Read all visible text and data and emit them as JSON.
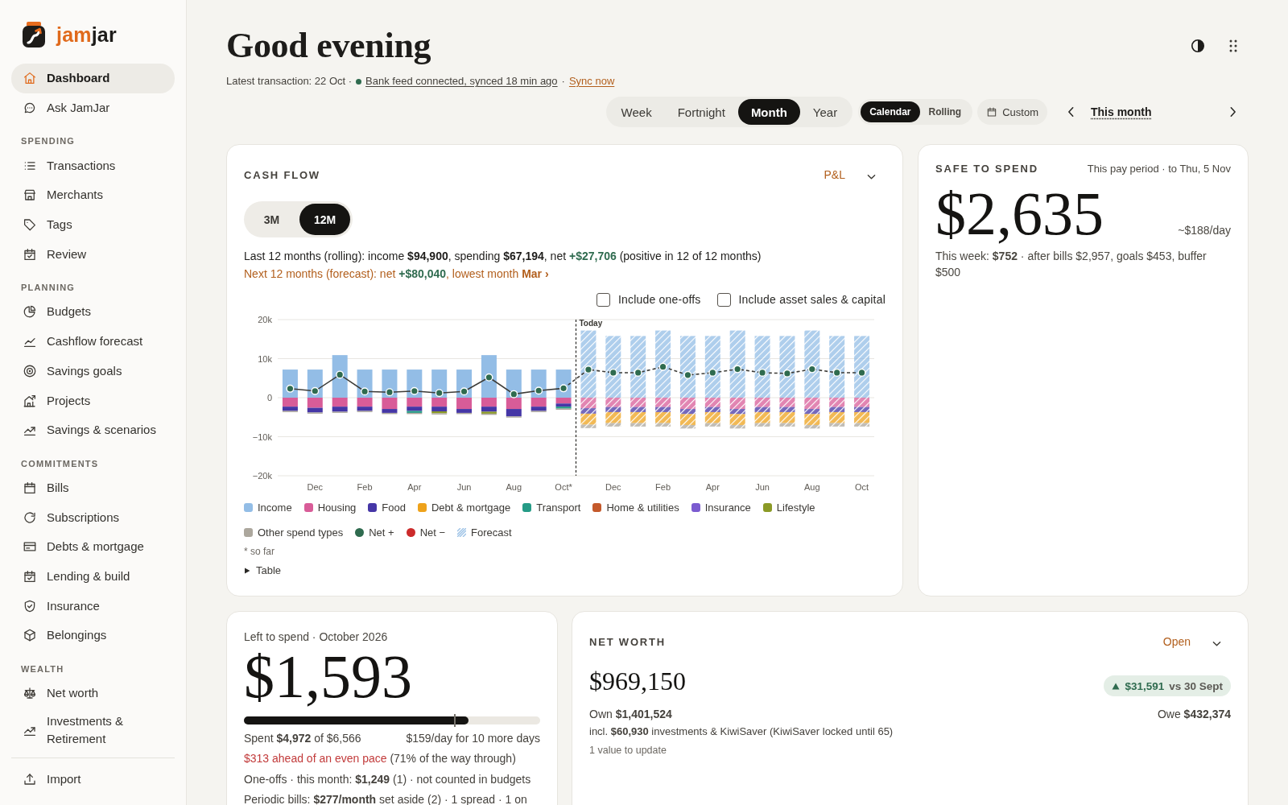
{
  "sidebar": {
    "logo": {
      "accent": "jam",
      "rest": "jar"
    },
    "sections": [
      {
        "items": [
          {
            "label": "Dashboard",
            "selected": true
          },
          {
            "label": "Ask JamJar",
            "selected": false
          }
        ]
      },
      {
        "title": "SPENDING",
        "items": [
          {
            "label": "Transactions",
            "selected": false
          },
          {
            "label": "Merchants",
            "selected": false
          },
          {
            "label": "Tags",
            "selected": false
          },
          {
            "label": "Review",
            "selected": false
          }
        ]
      },
      {
        "title": "PLANNING",
        "items": [
          {
            "label": "Budgets",
            "selected": false
          },
          {
            "label": "Cashflow forecast",
            "selected": false
          },
          {
            "label": "Savings goals",
            "selected": false
          },
          {
            "label": "Projects",
            "selected": false
          },
          {
            "label": "Savings & scenarios",
            "selected": false
          }
        ]
      },
      {
        "title": "COMMITMENTS",
        "items": [
          {
            "label": "Bills",
            "selected": false
          },
          {
            "label": "Subscriptions",
            "selected": false
          },
          {
            "label": "Debts & mortgage",
            "selected": false
          },
          {
            "label": "Lending & build",
            "selected": false
          },
          {
            "label": "Insurance",
            "selected": false
          },
          {
            "label": "Belongings",
            "selected": false
          }
        ]
      },
      {
        "title": "WEALTH",
        "items": [
          {
            "label": "Net worth",
            "selected": false
          },
          {
            "label": "Investments & Retirement",
            "selected": false
          }
        ]
      },
      {
        "items": [
          {
            "label": "Import",
            "selected": false
          }
        ]
      }
    ]
  },
  "header": {
    "title": "Good evening",
    "latest": "Latest transaction: 22 Oct ·",
    "bank_feed": {
      "text": "Bank feed connected, synced 18 min ago",
      "connected": true
    },
    "separator": "·",
    "sync_link": "Sync now"
  },
  "period": {
    "tabs": [
      {
        "label": "Week",
        "selected": false
      },
      {
        "label": "Fortnight",
        "selected": false
      },
      {
        "label": "Month",
        "selected": true
      },
      {
        "label": "Year",
        "selected": false
      }
    ],
    "modes": [
      {
        "label": "Calendar",
        "selected": true
      },
      {
        "label": "Rolling",
        "selected": false
      }
    ],
    "custom": "Custom",
    "current": "This month"
  },
  "cash_flow": {
    "title": "CASH FLOW",
    "view_link": "P&L",
    "ranges": [
      {
        "label": "3M",
        "selected": false
      },
      {
        "label": "12M",
        "selected": true
      }
    ],
    "summary": [
      {
        "text": "Last 12 months (rolling): income ",
        "kind": "plain"
      },
      {
        "text": "$94,900",
        "kind": "strong"
      },
      {
        "text": ", spending ",
        "kind": "plain"
      },
      {
        "text": "$67,194",
        "kind": "strong"
      },
      {
        "text": ", net ",
        "kind": "plain"
      },
      {
        "text": "+$27,706",
        "kind": "positive"
      },
      {
        "text": " (positive in 12 of 12 months)",
        "kind": "plain"
      }
    ],
    "forecast": [
      {
        "text": "Next 12 months (forecast): net ",
        "kind": "plain"
      },
      {
        "text": "+$80,040",
        "kind": "positive"
      },
      {
        "text": ", lowest month ",
        "kind": "plain"
      },
      {
        "text": "Mar ›",
        "kind": "strong"
      }
    ],
    "options": [
      {
        "label": "Include one-offs",
        "checked": false
      },
      {
        "label": "Include asset sales & capital",
        "checked": false
      }
    ],
    "chart_data": {
      "type": "bar",
      "stacked": true,
      "grid": true,
      "categories": [
        null,
        "Dec",
        null,
        "Feb",
        null,
        "Apr",
        null,
        "Jun",
        null,
        "Aug",
        null,
        "Oct*",
        null,
        "Dec",
        null,
        "Feb",
        null,
        "Apr",
        null,
        "Jun",
        null,
        "Aug",
        null,
        "Oct"
      ],
      "ylim": [
        -20000,
        20000
      ],
      "yticks": [
        {
          "value": 20000,
          "label": "20k"
        },
        {
          "value": 10000,
          "label": "10k"
        },
        {
          "value": 0,
          "label": "0"
        },
        {
          "value": -10000,
          "label": "−10k"
        },
        {
          "value": -20000,
          "label": "−20k"
        }
      ],
      "series": [
        {
          "name": "Income",
          "type": "bar",
          "color": "#93bde6",
          "values": [
            7200,
            7200,
            10900,
            7200,
            7200,
            7200,
            7200,
            7200,
            10900,
            7200,
            7200,
            7200,
            17200,
            15800,
            15800,
            17200,
            15800,
            15800,
            17200,
            15800,
            15800,
            17200,
            15800,
            15800
          ]
        },
        {
          "name": "Housing",
          "type": "bar",
          "color": "#d85c98",
          "values": [
            -2300,
            -2600,
            -2300,
            -2300,
            -2900,
            -2300,
            -2300,
            -2900,
            -2300,
            -2900,
            -2300,
            -1500,
            -2700,
            -2400,
            -2400,
            -2400,
            -2900,
            -2400,
            -2900,
            -2400,
            -2400,
            -2900,
            -2400,
            -2400
          ]
        },
        {
          "name": "Food",
          "type": "bar",
          "color": "#4536a6",
          "values": [
            -1100,
            -1200,
            -1300,
            -1100,
            -1000,
            -1100,
            -1200,
            -1000,
            -1300,
            -1900,
            -1100,
            -800,
            -1400,
            -1300,
            -1300,
            -1300,
            -1300,
            -1300,
            -1300,
            -1300,
            -1300,
            -1300,
            -1300,
            -1300
          ]
        },
        {
          "name": "Debt & mortgage",
          "type": "bar",
          "color": "#eea21b",
          "values": [
            0,
            0,
            0,
            0,
            0,
            0,
            0,
            0,
            0,
            0,
            0,
            0,
            -2800,
            -2800,
            -2800,
            -2800,
            -2800,
            -2800,
            -2800,
            -2800,
            -2800,
            -2800,
            -2800,
            -2800
          ]
        },
        {
          "name": "Transport",
          "type": "bar",
          "color": "#259b86",
          "values": [
            0,
            0,
            0,
            0,
            0,
            -500,
            0,
            0,
            0,
            0,
            0,
            -500,
            0,
            0,
            0,
            0,
            0,
            0,
            0,
            0,
            0,
            0,
            0,
            0
          ]
        },
        {
          "name": "Home & utilities",
          "type": "bar",
          "color": "#c4592b",
          "values": [
            0,
            0,
            0,
            0,
            0,
            0,
            0,
            0,
            0,
            0,
            0,
            0,
            0,
            0,
            0,
            0,
            0,
            0,
            0,
            0,
            0,
            0,
            0,
            0
          ]
        },
        {
          "name": "Insurance",
          "type": "bar",
          "color": "#7b5bd0",
          "values": [
            0,
            0,
            0,
            0,
            0,
            0,
            0,
            0,
            0,
            0,
            0,
            0,
            0,
            0,
            0,
            0,
            0,
            0,
            0,
            0,
            0,
            0,
            0,
            0
          ]
        },
        {
          "name": "Lifestyle",
          "type": "bar",
          "color": "#8b9a26",
          "values": [
            0,
            0,
            0,
            0,
            0,
            0,
            -500,
            0,
            -500,
            0,
            0,
            0,
            0,
            0,
            0,
            0,
            0,
            0,
            0,
            0,
            0,
            0,
            0,
            0
          ]
        },
        {
          "name": "Other spend types",
          "type": "bar",
          "color": "#aca79d",
          "values": [
            -300,
            -300,
            -300,
            -300,
            -300,
            -300,
            -300,
            -300,
            -300,
            -300,
            -300,
            -300,
            -900,
            -900,
            -900,
            -900,
            -900,
            -900,
            -900,
            -900,
            -900,
            -900,
            -900,
            -900
          ]
        },
        {
          "name": "Net +",
          "type": "line",
          "marker": "circle",
          "color": "#2f6b4f",
          "values": [
            2300,
            1700,
            5900,
            1600,
            1400,
            1700,
            1200,
            1600,
            5200,
            900,
            1800,
            2400,
            7200,
            6400,
            6400,
            7900,
            5800,
            6400,
            7300,
            6400,
            6200,
            7300,
            6400,
            6400
          ]
        }
      ],
      "annotations": [
        "Today"
      ]
    },
    "month_states": [
      {
        "forecast": false
      },
      {
        "forecast": false
      },
      {
        "forecast": false
      },
      {
        "forecast": false
      },
      {
        "forecast": false
      },
      {
        "forecast": false
      },
      {
        "forecast": false
      },
      {
        "forecast": false
      },
      {
        "forecast": false
      },
      {
        "forecast": false
      },
      {
        "forecast": false
      },
      {
        "forecast": false
      },
      {
        "forecast": true
      },
      {
        "forecast": true
      },
      {
        "forecast": true
      },
      {
        "forecast": true
      },
      {
        "forecast": true
      },
      {
        "forecast": true
      },
      {
        "forecast": true
      },
      {
        "forecast": true
      },
      {
        "forecast": true
      },
      {
        "forecast": true
      },
      {
        "forecast": true
      },
      {
        "forecast": true
      }
    ],
    "legend_extras": [
      {
        "label": "Net −",
        "color": "#cc2b2b",
        "kind": "dot"
      },
      {
        "label": "Forecast",
        "kind": "hatch"
      }
    ],
    "footnote": "* so far",
    "table_toggle": {
      "label": "Table",
      "expanded": false
    }
  },
  "safe_to_spend": {
    "title": "SAFE TO SPEND",
    "period": "This pay period · to Thu, 5 Nov",
    "amount": "$2,635",
    "per_day": "~$188/day",
    "detail": "This week: **$752** · after bills $2,957, goals $453, buffer $500"
  },
  "left_to_spend": {
    "title": "Left to spend · October 2026",
    "amount": "$1,593",
    "progress": {
      "level": 0.757
    },
    "pace_marker": {
      "level": 0.71
    },
    "spent": "Spent **$4,972** of $6,566",
    "per_day": "$159/day for 10 more days",
    "pace": [
      {
        "text": "$313 ahead of an even pace",
        "kind": "warning"
      },
      {
        "text": " (71% of the way through)",
        "kind": "plain"
      }
    ],
    "one_offs": "One-offs · this month: **$1,249** (1) · not counted in budgets",
    "periodic": "Periodic bills: **$277/month** set aside (2) · 1 spread · 1 on"
  },
  "net_worth": {
    "title": "NET WORTH",
    "open_link": "Open",
    "amount": "$969,150",
    "change": {
      "increase": true,
      "amount": "$31,591",
      "comparison": "vs 30 Sept"
    },
    "own": "Own **$1,401,524**",
    "owe": "Owe **$432,374**",
    "detail": "incl. **$60,930** investments & KiwiSaver (KiwiSaver locked until 65)",
    "note": "1 value to update"
  }
}
